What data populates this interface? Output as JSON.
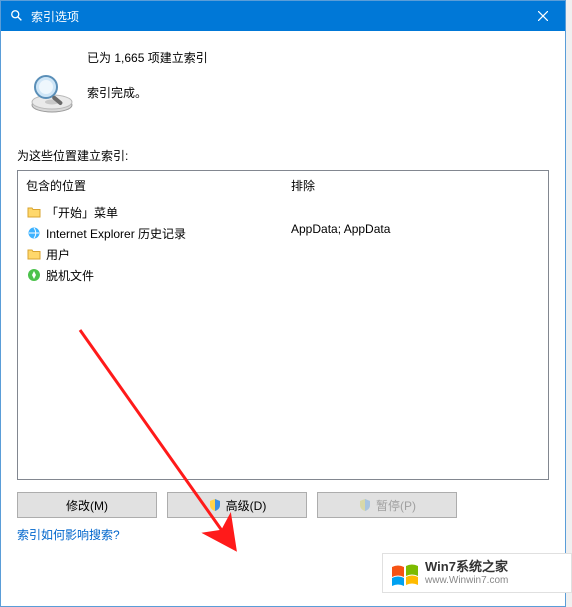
{
  "titlebar": {
    "title": "索引选项"
  },
  "status": {
    "line1": "已为 1,665 项建立索引",
    "line2": "索引完成。"
  },
  "section_label": "为这些位置建立索引:",
  "columns": {
    "included_header": "包含的位置",
    "excluded_header": "排除"
  },
  "included_items": [
    {
      "icon": "folder",
      "label": "「开始」菜单"
    },
    {
      "icon": "ie",
      "label": "Internet Explorer 历史记录"
    },
    {
      "icon": "folder",
      "label": "用户"
    },
    {
      "icon": "offline",
      "label": "脱机文件"
    }
  ],
  "excluded_text": "AppData; AppData",
  "buttons": {
    "modify": "修改(M)",
    "advanced": "高级(D)",
    "pause": "暂停(P)"
  },
  "help_link": "索引如何影响搜索?",
  "watermark": {
    "line1": "Win7系统之家",
    "line2": "www.Winwin7.com"
  }
}
